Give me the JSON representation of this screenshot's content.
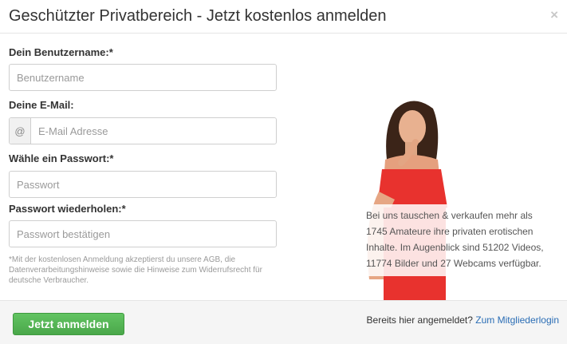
{
  "dialog": {
    "title": "Geschützter Privatbereich - Jetzt kostenlos anmelden",
    "close_symbol": "×",
    "close_icon": "close-icon"
  },
  "form": {
    "username": {
      "label": "Dein Benutzername:*",
      "placeholder": "Benutzername",
      "value": ""
    },
    "email": {
      "label": "Deine E-Mail:",
      "addon": "@",
      "placeholder": "E-Mail Adresse",
      "value": ""
    },
    "password": {
      "label": "Wähle ein Passwort:*",
      "placeholder": "Passwort",
      "value": ""
    },
    "password_repeat": {
      "label": "Passwort wiederholen:*",
      "placeholder": "Passwort bestätigen",
      "value": ""
    },
    "disclaimer": "*Mit der kostenlosen Anmeldung akzeptierst du unsere AGB, die Datenverarbeitungshinweise sowie die Hinweise zum Widerrufsrecht für deutsche Verbraucher."
  },
  "promo": {
    "part1": "Bei uns tauschen & verkaufen mehr als ",
    "amateurs": "1745",
    "part2": " Amateure ihre privaten erotischen Inhalte. Im Augenblick sind ",
    "videos": "51202",
    "part3": " Videos, ",
    "images": "11774",
    "part4": " Bilder und ",
    "webcams": "27",
    "part5": " Webcams verfügbar."
  },
  "footer": {
    "submit_label": "Jetzt anmelden",
    "already_text": "Bereits hier angemeldet?",
    "login_link": "Zum Mitgliederlogin"
  },
  "colors": {
    "button_green": "#5cb85c",
    "link_blue": "#2a6db5",
    "swimsuit_red": "#e8322e"
  }
}
